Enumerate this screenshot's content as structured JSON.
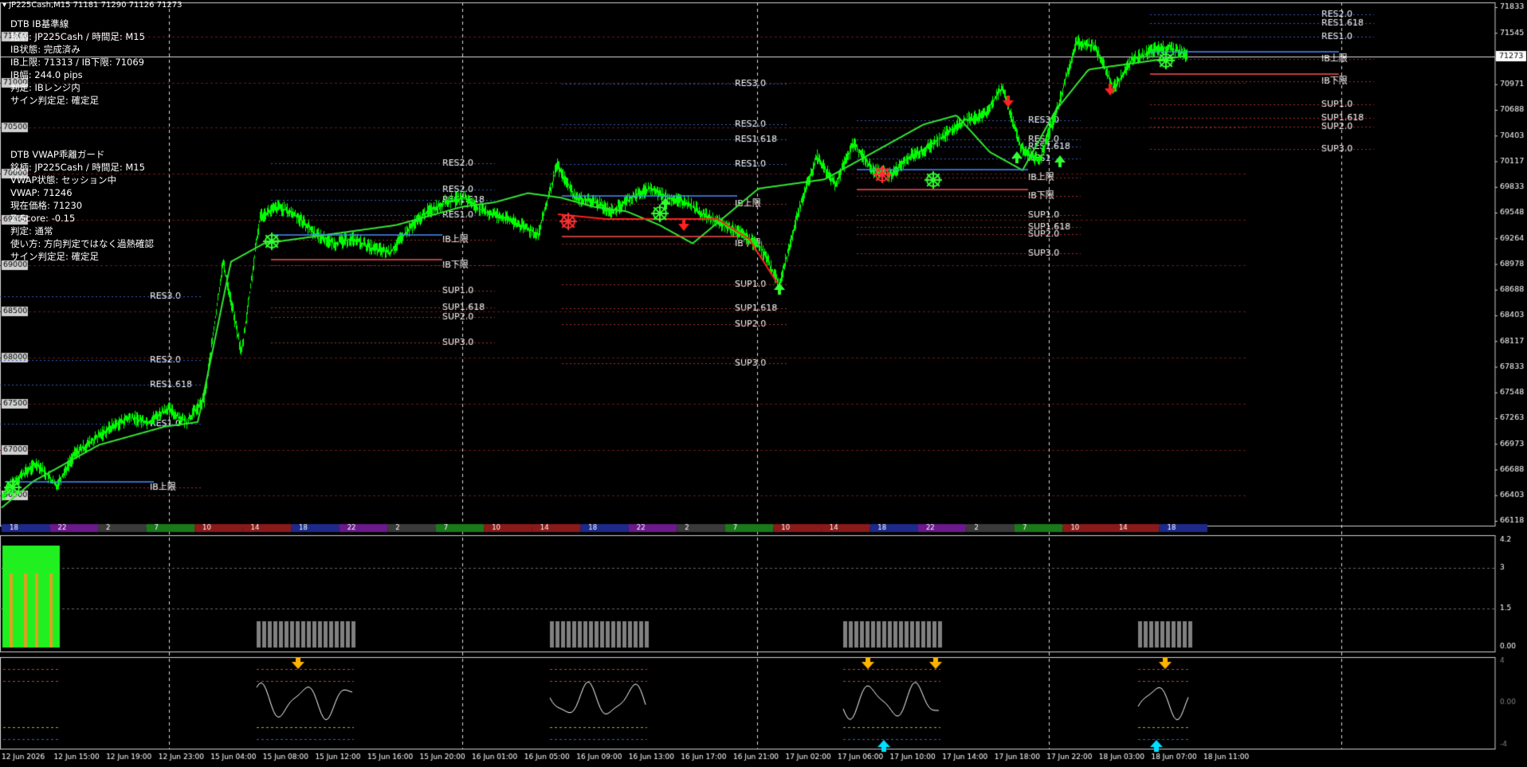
{
  "header": {
    "arrow": "▾",
    "symbol": "JP225Cash,M15",
    "ohlc": "71181 71290 71126 71273"
  },
  "panel_ib": {
    "lines": [
      "DTB IB基準線",
      "銘柄: JP225Cash / 時間足: M15",
      "IB状態: 完成済み",
      "IB上限: 71313 / IB下限: 71069",
      "IB幅: 244.0 pips",
      "判定: IBレンジ内",
      "サイン判定足: 確定足"
    ]
  },
  "panel_vwap": {
    "lines": [
      "DTB VWAP乖離ガード",
      "銘柄: JP225Cash / 時間足: M15",
      "VWAP状態: セッション中",
      "VWAP: 71246",
      "現在価格: 71230",
      "Z-Score: -0.15",
      "判定: 通常",
      "使い方: 方向判定ではなく過熱確認",
      "サイン判定足: 確定足"
    ]
  },
  "colors": {
    "candle": "#00ff00",
    "vwap": "#32e632",
    "vwap_down": "#ff2020",
    "ib_high": "#4a8cff",
    "ib_low": "#ff5050",
    "grid": "#d8d8d8",
    "label": "#ffffff"
  },
  "chart_data": {
    "type": "line",
    "symbol": "JP225Cash,M15",
    "price_axis": [
      "71833",
      "71545",
      "71273",
      "70971",
      "70688",
      "70403",
      "70117",
      "69833",
      "69548",
      "69264",
      "68978",
      "68688",
      "68403",
      "68117",
      "67833",
      "67548",
      "67263",
      "66973",
      "66688",
      "66403",
      "66118"
    ],
    "price_levels_labels": [
      "71500",
      "71000",
      "70500",
      "70000",
      "69500",
      "69000",
      "68500",
      "68000",
      "67500",
      "67000",
      "66500"
    ],
    "current_price": "71273",
    "price_range": [
      66118,
      71833
    ],
    "time_axis": [
      "12 Jun 2026",
      "12 Jun 15:00",
      "12 Jun 19:00",
      "12 Jun 23:00",
      "15 Jun 04:00",
      "15 Jun 08:00",
      "15 Jun 12:00",
      "15 Jun 16:00",
      "15 Jun 20:00",
      "16 Jun 01:00",
      "16 Jun 05:00",
      "16 Jun 09:00",
      "16 Jun 13:00",
      "16 Jun 17:00",
      "16 Jun 21:00",
      "17 Jun 02:00",
      "17 Jun 06:00",
      "17 Jun 10:00",
      "17 Jun 14:00",
      "17 Jun 18:00",
      "17 Jun 22:00",
      "18 Jun 03:00",
      "18 Jun 07:00",
      "18 Jun 11:00"
    ],
    "session_hours": [
      "18",
      "22",
      "2",
      "7",
      "10",
      "14",
      "18",
      "22",
      "2",
      "7",
      "10",
      "14",
      "18",
      "22",
      "2",
      "7",
      "10",
      "14",
      "18",
      "22",
      "2",
      "7",
      "10",
      "14",
      "18"
    ],
    "close_path": [
      66420,
      66650,
      66800,
      66550,
      66900,
      67050,
      67200,
      67300,
      67250,
      67400,
      67250,
      67500,
      69000,
      68000,
      69500,
      69600,
      69500,
      69300,
      69200,
      69250,
      69150,
      69100,
      69350,
      69550,
      69650,
      69700,
      69550,
      69500,
      69400,
      69300,
      70050,
      69700,
      69650,
      69550,
      69700,
      69800,
      69700,
      69650,
      69500,
      69400,
      69300,
      69150,
      68750,
      69550,
      70150,
      69850,
      70300,
      70000,
      69950,
      70150,
      70250,
      70400,
      70550,
      70600,
      70900,
      70250,
      70100,
      70700,
      71400,
      71350,
      70900,
      71200,
      71300,
      71350,
      71250
    ],
    "vwap_path": [
      66300,
      66600,
      66800,
      67000,
      67100,
      67200,
      67250,
      69000,
      69200,
      69250,
      69300,
      69350,
      69400,
      69500,
      69600,
      69650,
      69750,
      69700,
      69600,
      69550,
      69400,
      69200,
      69500,
      69800,
      69850,
      69900,
      70100,
      70300,
      70500,
      70600,
      70200,
      70000,
      70650,
      71100,
      71150,
      71200,
      71250
    ],
    "ib_zones": [
      {
        "high": 66680,
        "low": null
      },
      {
        "high": 69420,
        "low": 69080
      },
      {
        "high": 69760,
        "low": 69300
      },
      {
        "high": 70050,
        "low": 69850
      },
      {
        "high": 71313,
        "low": 71069
      }
    ],
    "level_labels": [
      {
        "set": 1,
        "labels": [
          "RES3.0",
          "RES2.0",
          "RES1.618",
          "RES1.0",
          "IB上限"
        ]
      },
      {
        "set": 2,
        "labels": [
          "RES2.0",
          "RES2.0",
          "RES1.618",
          "RES1.0",
          "IB上限",
          "IB下限",
          "SUP1.0",
          "SUP1.618",
          "SUP2.0",
          "SUP3.0"
        ]
      },
      {
        "set": 3,
        "labels": [
          "RES3.0",
          "RES2.0",
          "RES1.618",
          "RES1.0",
          "IB上限",
          "IB下限",
          "SUP1.0",
          "SUP1.618",
          "SUP2.0",
          "SUP3.0"
        ]
      },
      {
        "set": 4,
        "labels": [
          "RES3.0",
          "RES2.0",
          "RES1.618",
          "RES1",
          "IB上限",
          "IB下限",
          "SUP1.0",
          "SUP1.618",
          "SUP2.0",
          "SUP3.0"
        ]
      },
      {
        "set": 5,
        "labels": [
          "RES2.0",
          "RES1.618",
          "RES1.0",
          "IB上限",
          "IB下限",
          "SUP1.0",
          "SUP1.618",
          "SUP2.0",
          "SUP3.0"
        ]
      }
    ],
    "sub1_axis": [
      "4.2",
      "3",
      "1.5",
      "0.00"
    ],
    "sub2_axis": [
      "4",
      "0.00",
      "-4"
    ]
  }
}
